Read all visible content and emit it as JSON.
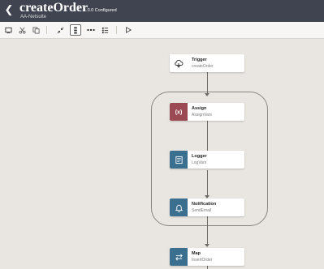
{
  "header": {
    "title": "createOrder",
    "subtitle": "AA-Netsuite",
    "status": "1.0.0 Configured"
  },
  "toolbar": {
    "icons": [
      "screen-icon",
      "scissors-icon",
      "copy-icon",
      "collapse-icon",
      "vertical-layout-icon",
      "horizontal-layout-icon",
      "tree-layout-icon",
      "run-icon"
    ]
  },
  "nodes": [
    {
      "title": "Trigger",
      "subtitle": "createOrder",
      "icon": "trigger-icon",
      "color": "#ffffff"
    },
    {
      "title": "Assign",
      "subtitle": "AssignVars",
      "icon": "variable-icon",
      "color": "#9b4a54"
    },
    {
      "title": "Logger",
      "subtitle": "LogVars",
      "icon": "logger-icon",
      "color": "#3a6f8f"
    },
    {
      "title": "Notification",
      "subtitle": "SendEmail",
      "icon": "bell-icon",
      "color": "#3a6f8f"
    },
    {
      "title": "Map",
      "subtitle": "InsertOrder",
      "icon": "map-icon",
      "color": "#3a6f8f"
    }
  ]
}
